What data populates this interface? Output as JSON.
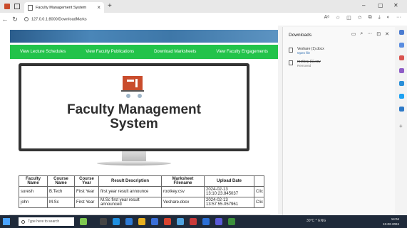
{
  "browser": {
    "tab_title": "Faculty Management System",
    "url": "127.0.0.1:8000/DownloadMarks",
    "new_tab_label": "+",
    "minimize": "–",
    "maximize": "▢",
    "close": "✕"
  },
  "nav": {
    "items": [
      "View Lecture Schedules",
      "View Faculty Publications",
      "Download Marksheets",
      "View Faculty Engagements"
    ]
  },
  "hero": {
    "title_line1": "Faculty Management",
    "title_line2": "System"
  },
  "table": {
    "headers": [
      "Faculty Name",
      "Course Name",
      "Course Year",
      "Result Description",
      "Marksheet Filename",
      "Upload Date",
      ""
    ],
    "rows": [
      [
        "suresh",
        "B.Tech",
        "First Year",
        "first year result announce",
        "rootkey.csv",
        "2024-02-13 13:10:23.845037",
        "Clic Dow"
      ],
      [
        "john",
        "M.Sc",
        "First Year",
        "M.Sc first year result announced",
        "Veshare.docx",
        "2024-02-13 13:57:55.057961",
        "Clic Dow"
      ]
    ]
  },
  "downloads": {
    "title": "Downloads",
    "items": [
      {
        "name": "Veshare (1).docx",
        "status": "Open file",
        "removed": false
      },
      {
        "name": "rootkey (1).csv",
        "status": "Removed",
        "removed": true
      }
    ]
  },
  "taskbar": {
    "search_placeholder": "Type here to search",
    "tray_text": "30°C  ^  ENG",
    "time": "14:04",
    "date": "13-02-2024"
  },
  "colors": {
    "nav_green": "#22c34a",
    "accent_red": "#c94c2c"
  }
}
